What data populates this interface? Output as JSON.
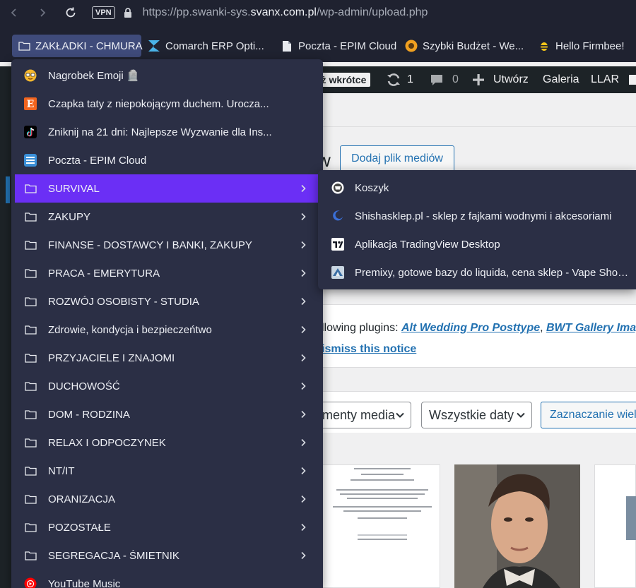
{
  "browser": {
    "url_prefix": "https://pp.swanki-sys.",
    "url_domain": "svanx.com.pl",
    "url_path": "/wp-admin/upload.php",
    "vpn_label": "VPN"
  },
  "bookmarks_bar": [
    {
      "label": "ZAKŁADKI - CHMURA",
      "icon": "folder-icon"
    },
    {
      "label": "Comarch ERP Opti...",
      "icon": "comarch-icon"
    },
    {
      "label": "Poczta - EPIM Cloud",
      "icon": "page-icon"
    },
    {
      "label": "Szybki Budżet - We...",
      "icon": "budget-icon"
    },
    {
      "label": "Hello Firmbee!",
      "icon": "firmbee-icon"
    }
  ],
  "menu": {
    "items": [
      {
        "label": "Nagrobek Emoji 🪦",
        "icon": "emoji-face-icon",
        "type": "link"
      },
      {
        "label": "Czapka taty z niepokojącym duchem. Urocza...",
        "icon": "etsy-icon",
        "type": "link"
      },
      {
        "label": "Zniknij na 21 dni: Najlepsze Wyzwanie dla Ins...",
        "icon": "tiktok-icon",
        "type": "link"
      },
      {
        "label": "Poczta - EPIM Cloud",
        "icon": "epim-icon",
        "type": "link"
      },
      {
        "label": "SURVIVAL",
        "icon": "folder-icon",
        "type": "folder",
        "active": true
      },
      {
        "label": "ZAKUPY",
        "icon": "folder-icon",
        "type": "folder"
      },
      {
        "label": "FINANSE -  DOSTAWCY I BANKI, ZAKUPY",
        "icon": "folder-icon",
        "type": "folder"
      },
      {
        "label": "PRACA - EMERYTURA",
        "icon": "folder-icon",
        "type": "folder"
      },
      {
        "label": "ROZWÓJ OSOBISTY - STUDIA",
        "icon": "folder-icon",
        "type": "folder"
      },
      {
        "label": "Zdrowie, kondycja i bezpieczeńtwo",
        "icon": "folder-icon",
        "type": "folder"
      },
      {
        "label": "PRZYJACIELE I ZNAJOMI",
        "icon": "folder-icon",
        "type": "folder"
      },
      {
        "label": "DUCHOWOŚĆ",
        "icon": "folder-icon",
        "type": "folder"
      },
      {
        "label": "DOM - RODZINA",
        "icon": "folder-icon",
        "type": "folder"
      },
      {
        "label": "RELAX I ODPOCZYNEK",
        "icon": "folder-icon",
        "type": "folder"
      },
      {
        "label": "NT/IT",
        "icon": "folder-icon",
        "type": "folder"
      },
      {
        "label": "ORANIZACJA",
        "icon": "folder-icon",
        "type": "folder"
      },
      {
        "label": "POZOSTAŁE",
        "icon": "folder-icon",
        "type": "folder"
      },
      {
        "label": "SEGREGACJA - ŚMIETNIK",
        "icon": "folder-icon",
        "type": "folder"
      },
      {
        "label": "YouTube Music",
        "icon": "youtube-music-icon",
        "type": "link"
      }
    ]
  },
  "submenu": {
    "items": [
      {
        "label": "Koszyk",
        "icon": "koszyk-icon"
      },
      {
        "label": "Shishasklep.pl - sklep z fajkami wodnymi i akcesoriami",
        "icon": "shisha-icon"
      },
      {
        "label": "Aplikacja TradingView Desktop",
        "icon": "tradingview-icon"
      },
      {
        "label": "Premixy, gotowe bazy do liquida, cena sklep - Vape Shop...",
        "icon": "vape-icon"
      }
    ]
  },
  "wp": {
    "soon": "uż wkrótce",
    "updates": "1",
    "comments": "0",
    "new": "Utwórz",
    "gallery": "Galeria",
    "llar": "LLAR",
    "title_tail": "w",
    "add_media": "Dodaj plik mediów",
    "notice_prefix": "llowing plugins: ",
    "plugin1": "Alt Wedding Pro Posttype",
    "notice_sep": ", ",
    "plugin2": "BWT Gallery Imag",
    "dismiss": "ismiss this notice",
    "filter_type": "menty media",
    "filter_date": "Wszystkie daty",
    "bulk_select": "Zaznaczanie wielu"
  },
  "colors": {
    "menu_bg": "#2b2f45",
    "active": "#6b2ff5",
    "wp_blue": "#2271b1"
  }
}
